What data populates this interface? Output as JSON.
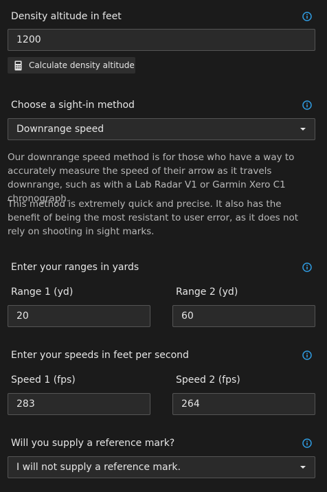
{
  "density": {
    "label": "Density altitude in feet",
    "value": "1200",
    "calc_button_label": "Calculate density altitude"
  },
  "sight_method": {
    "label": "Choose a sight-in method",
    "selected": "Downrange speed",
    "description_1": "Our downrange speed method is for those who have a way to accurately measure the speed of their arrow as it travels downrange, such as with a Lab Radar V1 or Garmin Xero C1 chronograph.",
    "description_2": "This method is extremely quick and precise. It also has the benefit of being the most resistant to user error, as it does not rely on shooting in sight marks."
  },
  "ranges": {
    "label": "Enter your ranges in yards",
    "range1_label": "Range 1 (yd)",
    "range1_value": "20",
    "range2_label": "Range 2 (yd)",
    "range2_value": "60"
  },
  "speeds": {
    "label": "Enter your speeds in feet per second",
    "speed1_label": "Speed 1 (fps)",
    "speed1_value": "283",
    "speed2_label": "Speed 2 (fps)",
    "speed2_value": "264"
  },
  "reference": {
    "label": "Will you supply a reference mark?",
    "selected": "I will not supply a reference mark."
  },
  "colors": {
    "background": "#1b1b1b",
    "field_background": "#2a2a2a",
    "field_border": "#555555",
    "info_accent": "#2f9be0",
    "text": "#e6e6e6",
    "muted_text": "#b9b9b9"
  },
  "icons": {
    "info": "info-circle-icon",
    "calculator": "calculator-icon",
    "dropdown": "caret-down-icon"
  }
}
